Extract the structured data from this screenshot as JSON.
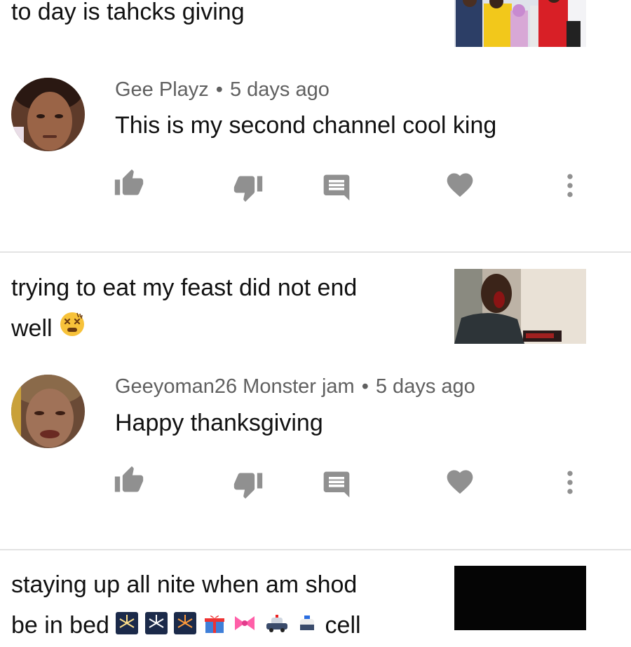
{
  "posts": [
    {
      "title": "to day is tahcks giving",
      "thumbnail_icon": "family-photo-thumbnail",
      "comment": {
        "author": "Gee Playz",
        "time": "5 days ago",
        "text": "This is my second channel cool king"
      }
    },
    {
      "title": "trying to eat my feast did not end well",
      "title_emoji": "dizzy-face-emoji",
      "thumbnail_icon": "screaming-man-thumbnail",
      "comment": {
        "author": "Geeyoman26 Monster jam",
        "time": "5 days ago",
        "text": "Happy thanksgiving"
      }
    },
    {
      "title_line1": "staying up all nite when am shod",
      "title_line2_start": "be in bed",
      "title_line2_end": "cell",
      "title_emojis": [
        "fireworks-emoji",
        "fireworks-emoji",
        "fireworks-emoji",
        "gift-emoji",
        "ribbon-emoji",
        "police-car-emoji",
        "police-car-emoji"
      ],
      "thumbnail_icon": "dark-thumbnail"
    }
  ],
  "separator": "•",
  "colors": {
    "meta_text": "#606060",
    "icon": "#909090",
    "divider": "#e3e3e3"
  }
}
